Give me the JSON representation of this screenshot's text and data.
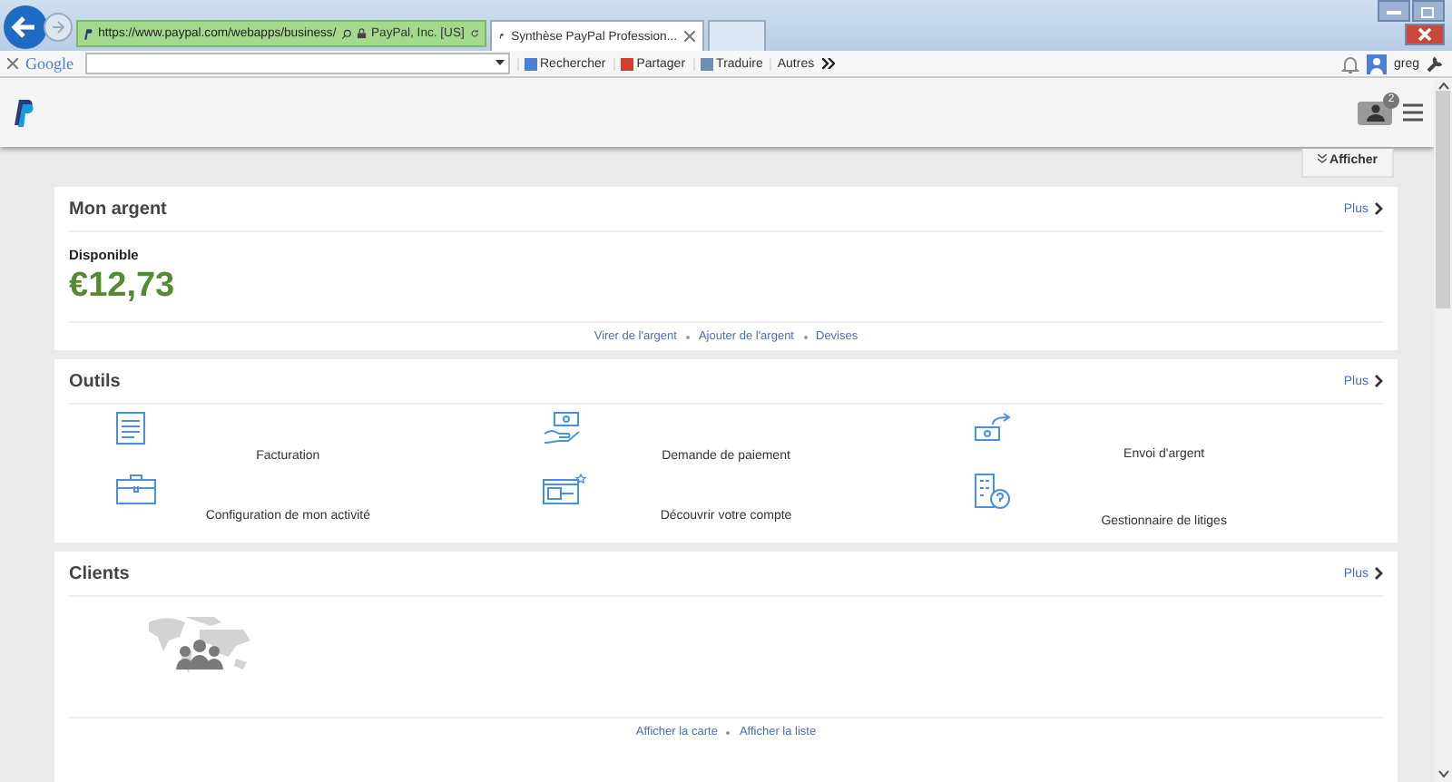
{
  "browser": {
    "address": "https://www.paypal.com/webapps/business/",
    "site_identity": "PayPal, Inc. [US]",
    "tab_title": "Synthèse PayPal Profession..."
  },
  "toolbar": {
    "logo": "Google",
    "items": [
      "Rechercher",
      "Partager",
      "Traduire",
      "Autres"
    ],
    "user": "greg"
  },
  "header": {
    "notification_count": "2",
    "show_button": "Afficher"
  },
  "money": {
    "title": "Mon argent",
    "more": "Plus",
    "label": "Disponible",
    "balance": "€12,73",
    "links": [
      "Virer de l'argent",
      "Ajouter de l'argent",
      "Devises"
    ]
  },
  "tools": {
    "title": "Outils",
    "more": "Plus",
    "items": [
      "Facturation",
      "Demande de paiement",
      "Envoi d'argent",
      "Configuration de mon activité",
      "Découvrir votre compte",
      "Gestionnaire de litiges"
    ]
  },
  "clients": {
    "title": "Clients",
    "more": "Plus",
    "links": [
      "Afficher la carte",
      "Afficher la liste"
    ]
  }
}
